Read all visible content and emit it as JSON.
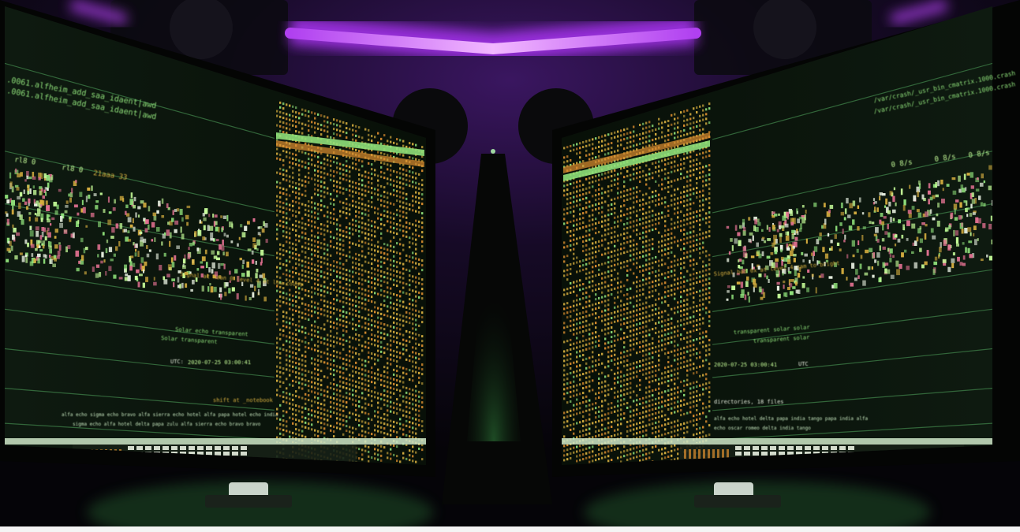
{
  "scene": {
    "description_hidden": "",
    "colors": {
      "neon": "#c04dff",
      "neon_glow": "#7a1fb8",
      "backdrop": "#140a22",
      "screen_bg": "#0c140e",
      "screen_line": "#3c7a45",
      "term_green": "#8fe07a",
      "term_bright": "#c8ff9a",
      "term_yellow": "#d8b040",
      "term_orange": "#e09030",
      "term_white": "#e8f0e0",
      "term_pink": "#e07090",
      "bezel": "#050605",
      "floor_glow": "#2f7a3a"
    },
    "left_monitor": {
      "header_lines": [
        ".0061.alfheim_add_saa_idaent|awd",
        ".0061.alfheim_add_saa_idaent|awd"
      ],
      "row_labels": [
        "rl8 0",
        "rl8 0",
        "21aaa 33"
      ],
      "status_left": "Signal at mean 0 level 4 at low count",
      "center_label_1": "Solar echo transparent",
      "center_label_2": "Solar transparent",
      "utc_label": "UTC:",
      "utc_value": "2020-07-25 03:00:41",
      "note": "shift at _notebook",
      "footer_1": "alfa echo sigma echo bravo alfa sierra echo hotel alfa papa hotel echo india",
      "footer_2": "sigma echo alfa hotel delta papa zulu alfa sierra echo bravo bravo"
    },
    "right_monitor": {
      "header_lines": [
        "/var/crash/_usr_bin_cmatrix.1000.crash",
        "/var/crash/_usr_bin_cmatrix.1000.crash"
      ],
      "row_labels": [
        "0 8/s",
        "0 8/s",
        "0 8/s"
      ],
      "status_right": "Signal bad 0x at level 4 ram to bright",
      "center_label_1": "transparent solar solar",
      "center_label_2": "transparent solar",
      "utc_label": "UTC",
      "utc_value": "2020-07-25 03:00:41",
      "note": "directories, 18 files",
      "footer_1": "alfa echo hotel delta papa india tango papa india alfa",
      "footer_2": "echo oscar romeo delta india tango"
    }
  }
}
